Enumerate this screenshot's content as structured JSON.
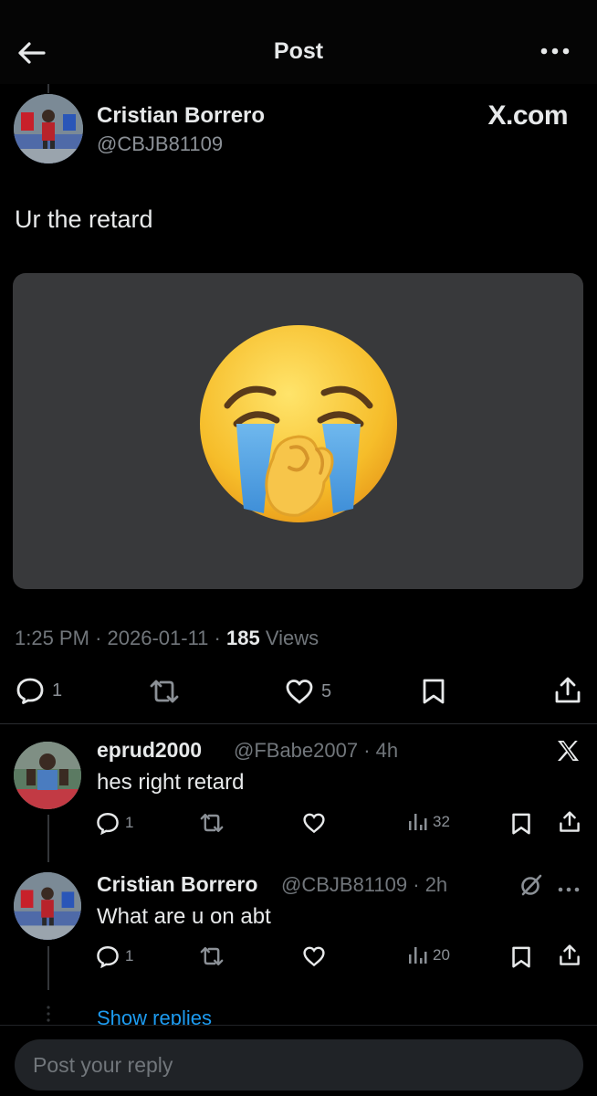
{
  "header": {
    "title": "Post"
  },
  "post": {
    "author_name": "Cristian Borrero",
    "author_handle": "@CBJB81109",
    "brand": "X.com",
    "text": "Ur the retard",
    "media_emoji": "loudly-crying-face",
    "time": "1:25 PM",
    "date": "2026-01-11",
    "views_count": "185",
    "views_label": "Views",
    "replies": "1",
    "likes": "5"
  },
  "replies": [
    {
      "name": "eprud2000",
      "handle": "@FBabe2007",
      "age": "4h",
      "text": "hes right retard",
      "reply_count": "1",
      "views": "32",
      "badge_icon": "x-logo-icon"
    },
    {
      "name": "Cristian Borrero",
      "handle": "@CBJB81109",
      "age": "2h",
      "text": "What are u on abt",
      "reply_count": "1",
      "views": "20",
      "badge_icon": "grok-icon"
    }
  ],
  "show_replies": "Show replies",
  "reply_box": {
    "placeholder": "Post your reply"
  },
  "colors": {
    "background": "#000000",
    "card": "#38393b",
    "muted_text": "#71767b",
    "link": "#1d9bf0"
  }
}
